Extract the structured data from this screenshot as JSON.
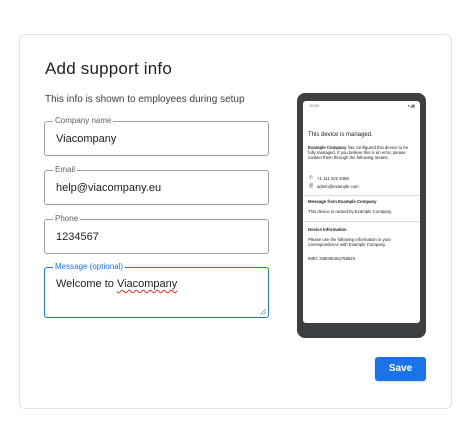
{
  "header": {
    "title": "Add support info",
    "subtitle": "This info is shown to employees during setup"
  },
  "form": {
    "company_name": {
      "label": "Company name",
      "value": "Viacompany"
    },
    "email": {
      "label": "Email",
      "value": "help@viacompany.eu"
    },
    "phone": {
      "label": "Phone",
      "value": "1234567"
    },
    "message": {
      "label": "Message (optional)",
      "value_prefix": "Welcome to ",
      "value_misspelled": "Viacompany"
    }
  },
  "preview": {
    "status_time": "10:00",
    "status_icons": "▾◢▮",
    "managed_heading": "This device is managed.",
    "managed_company": "Example Company",
    "managed_text": " has configured this device to be fully managed. If you believe this is an error, please contact them through the following means:",
    "phone": "+1 111 222 3456",
    "email": "admin@example.com",
    "message_heading": "Message from Example Company",
    "message_text": "This device is owned by Example Company.",
    "device_heading": "Device Information",
    "device_text": "Please use the following information in your correspondence with Example Company.",
    "imei": "IMEI: 348036454759523"
  },
  "actions": {
    "save_label": "Save"
  },
  "colors": {
    "accent": "#1a73e8",
    "phone_frame": "#3c4043",
    "spellcheck": "#d93025"
  },
  "icons": {
    "phone": "phone-icon",
    "email": "at-icon",
    "resize": "resize-handle-icon"
  }
}
